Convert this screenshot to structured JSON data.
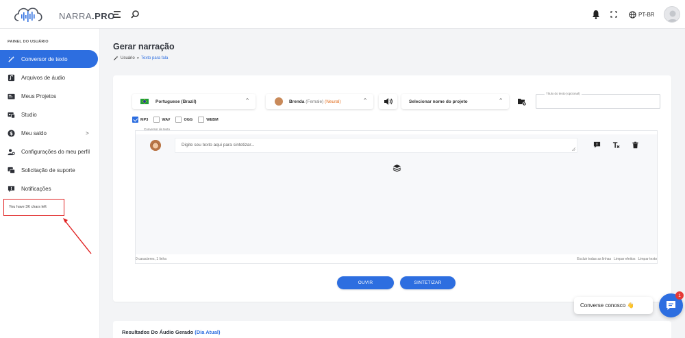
{
  "brand": {
    "name_light": "NARRA",
    "name_bold": ".PRO"
  },
  "topbar": {
    "language": "PT-BR"
  },
  "sidebar": {
    "header": "PAINEL DO USUÁRIO",
    "items": [
      {
        "label": "Conversor de texto",
        "icon": "magic-wand-icon",
        "active": true
      },
      {
        "label": "Arquivos de áudio",
        "icon": "audio-file-icon"
      },
      {
        "label": "Meus Projetos",
        "icon": "projects-icon"
      },
      {
        "label": "Studio",
        "icon": "studio-icon"
      },
      {
        "label": "Meu saldo",
        "icon": "dollar-icon",
        "chevron": ">"
      },
      {
        "label": "Configurações do meu perfil",
        "icon": "user-settings-icon"
      },
      {
        "label": "Solicitação de suporte",
        "icon": "support-icon"
      },
      {
        "label": "Notificações",
        "icon": "notification-icon"
      }
    ],
    "chars_left": "You have 3K chars left"
  },
  "page": {
    "title": "Gerar narração",
    "breadcrumb": {
      "root": "Usuário",
      "separator": "»",
      "current": "Texto para fala"
    }
  },
  "form": {
    "language": "Portuguese (Brazil)",
    "voice": {
      "name": "Brenda",
      "gender": "(Female)",
      "engine": "(Neural)"
    },
    "project": "Selecionar nome do projeto",
    "title_label": "Título do texto (opcional)",
    "formats": [
      {
        "label": "MP3",
        "checked": true
      },
      {
        "label": "WAV",
        "checked": false
      },
      {
        "label": "OGG",
        "checked": false
      },
      {
        "label": "WEBM",
        "checked": false
      }
    ],
    "editor_label": "Conversor de texto",
    "placeholder": "Digite seu texto aqui para sintetizar...",
    "stats": "0 caracteres, 1 linha",
    "actions": [
      "Excluir todas as linhas",
      "Limpar efeitos",
      "Limpar texto"
    ],
    "listen": "OUVIR",
    "synthesize": "SINTETIZAR"
  },
  "results": {
    "title": "Resultados Do Áudio Gerado",
    "period": "(Dia Atual)"
  },
  "chat": {
    "label": "Converse conosco 👋",
    "badge": "1"
  },
  "colors": {
    "primary": "#2d6ee0",
    "annotation": "#e02020",
    "neural": "#e26b1a",
    "badge": "#e53935"
  }
}
